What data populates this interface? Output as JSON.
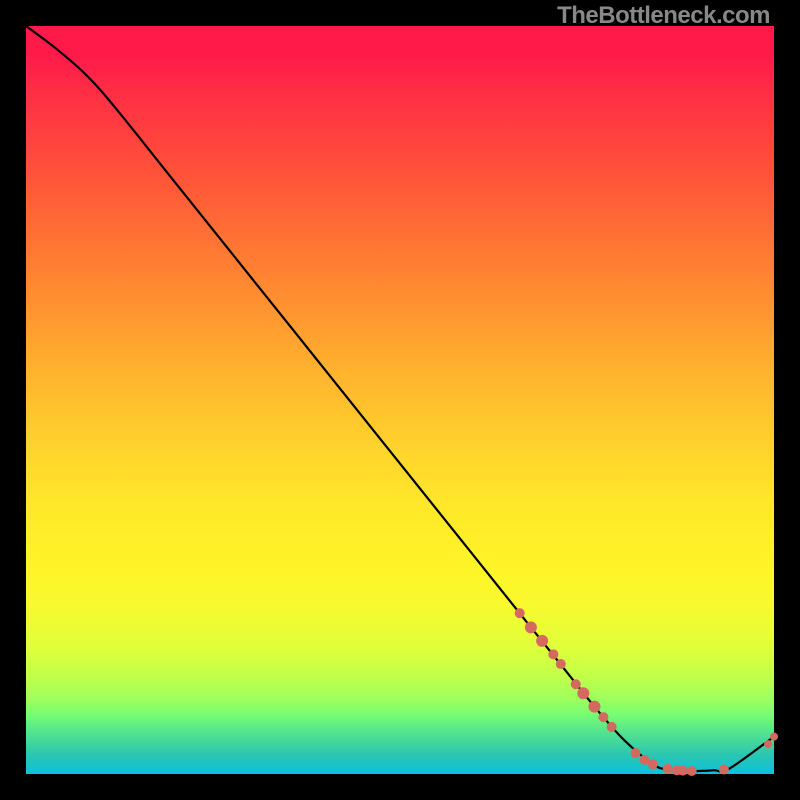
{
  "watermark": "TheBottleneck.com",
  "chart_data": {
    "type": "line",
    "xlim": [
      0,
      100
    ],
    "ylim": [
      0,
      100
    ],
    "xlabel": "",
    "ylabel": "",
    "title": "",
    "series": [
      {
        "name": "curve",
        "x": [
          0,
          4,
          8,
          12,
          20,
          30,
          40,
          50,
          60,
          68,
          72,
          76,
          80,
          84,
          86,
          88,
          90,
          92,
          94,
          100
        ],
        "values": [
          100,
          97,
          93.5,
          89,
          79,
          66.5,
          54,
          41.5,
          29,
          19,
          14,
          9,
          4.5,
          1.2,
          0.6,
          0.4,
          0.4,
          0.5,
          0.7,
          5
        ]
      }
    ],
    "markers": {
      "name": "dots",
      "color": "#d46a5f",
      "points": [
        {
          "x": 66,
          "y": 21.5,
          "r": 5
        },
        {
          "x": 67.5,
          "y": 19.6,
          "r": 6
        },
        {
          "x": 69,
          "y": 17.8,
          "r": 6
        },
        {
          "x": 70.5,
          "y": 16.0,
          "r": 5
        },
        {
          "x": 71.5,
          "y": 14.7,
          "r": 5
        },
        {
          "x": 73.5,
          "y": 12.0,
          "r": 5
        },
        {
          "x": 74.5,
          "y": 10.8,
          "r": 6
        },
        {
          "x": 76,
          "y": 9.0,
          "r": 6
        },
        {
          "x": 77.2,
          "y": 7.6,
          "r": 5
        },
        {
          "x": 78.3,
          "y": 6.3,
          "r": 5
        },
        {
          "x": 81.5,
          "y": 2.8,
          "r": 5
        },
        {
          "x": 82.7,
          "y": 1.9,
          "r": 5
        },
        {
          "x": 83.8,
          "y": 1.3,
          "r": 5
        },
        {
          "x": 85.8,
          "y": 0.7,
          "r": 5
        },
        {
          "x": 87,
          "y": 0.5,
          "r": 5
        },
        {
          "x": 87.8,
          "y": 0.45,
          "r": 5
        },
        {
          "x": 89,
          "y": 0.4,
          "r": 5
        },
        {
          "x": 93.3,
          "y": 0.6,
          "r": 5
        },
        {
          "x": 99.2,
          "y": 4.0,
          "r": 4
        },
        {
          "x": 100,
          "y": 5.0,
          "r": 4
        }
      ]
    }
  }
}
